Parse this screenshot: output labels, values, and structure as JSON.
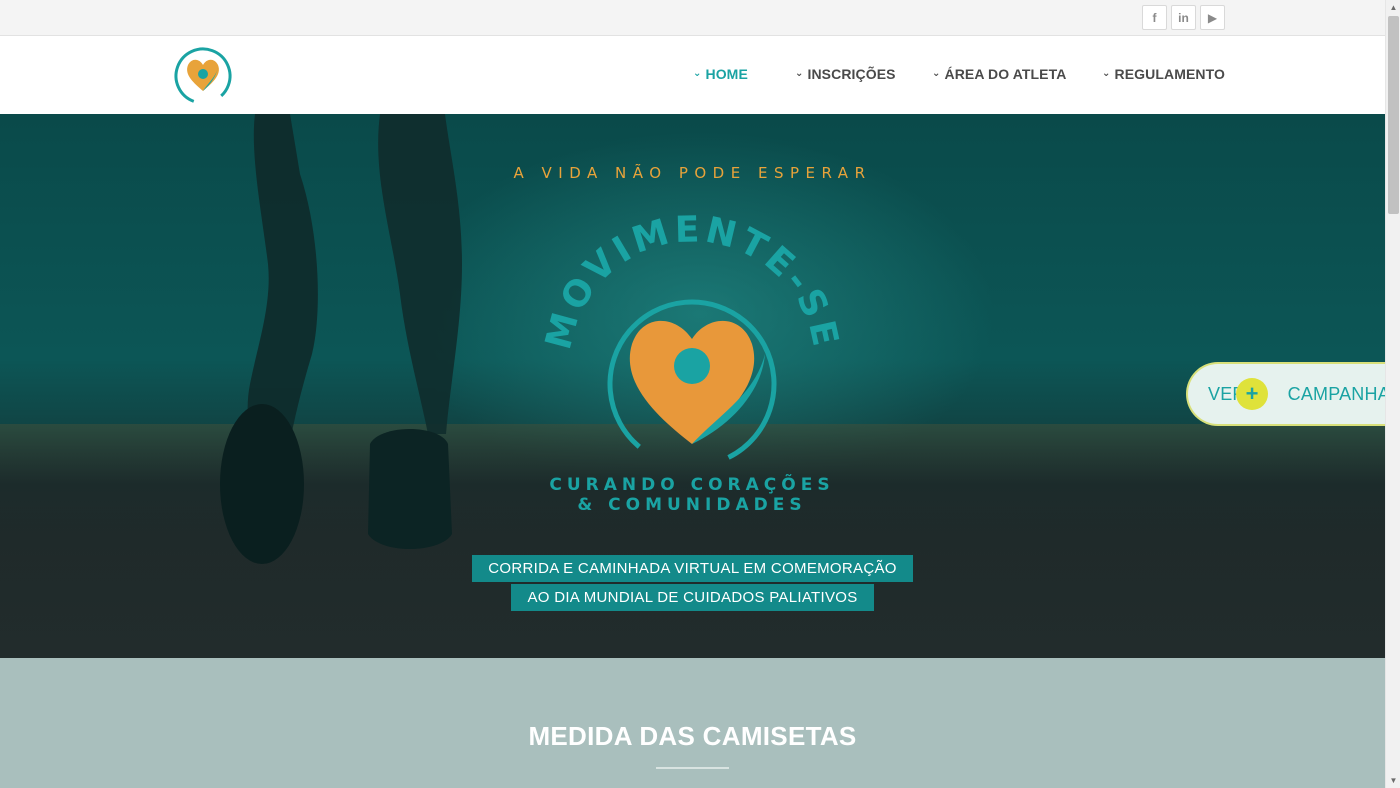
{
  "topbar": {
    "social": [
      {
        "label": "f",
        "icon": "facebook-icon"
      },
      {
        "label": "in",
        "icon": "linkedin-icon"
      },
      {
        "label": "▶",
        "icon": "youtube-icon"
      }
    ]
  },
  "nav": {
    "items": [
      {
        "label": "HOME",
        "active": true
      },
      {
        "label": "INSCRIÇÕES",
        "active": false
      },
      {
        "label": "ÁREA DO ATLETA",
        "active": false
      },
      {
        "label": "REGULAMENTO",
        "active": false
      }
    ]
  },
  "hero": {
    "tagline": "A VIDA NÃO PODE ESPERAR",
    "logo": {
      "arc_text": "MOVIMENTE-SE",
      "subtitle_line1": "CURANDO CORAÇÕES",
      "subtitle_line2": "& COMUNIDADES"
    },
    "band_line1": "CORRIDA E CAMINHADA VIRTUAL EM COMEMORAÇÃO",
    "band_line2": "AO DIA MUNDIAL DE CUIDADOS PALIATIVOS"
  },
  "campaigns_button": {
    "label": "VER + CAMPANHAS",
    "text_left": "VER",
    "text_right": "CAMPANHAS",
    "plus": "+"
  },
  "section": {
    "title": "MEDIDA DAS CAMISETAS"
  },
  "colors": {
    "accent": "#1aa3a3",
    "orange": "#e8a33a",
    "band": "#138a8a",
    "section_bg": "#a9bfbd"
  }
}
